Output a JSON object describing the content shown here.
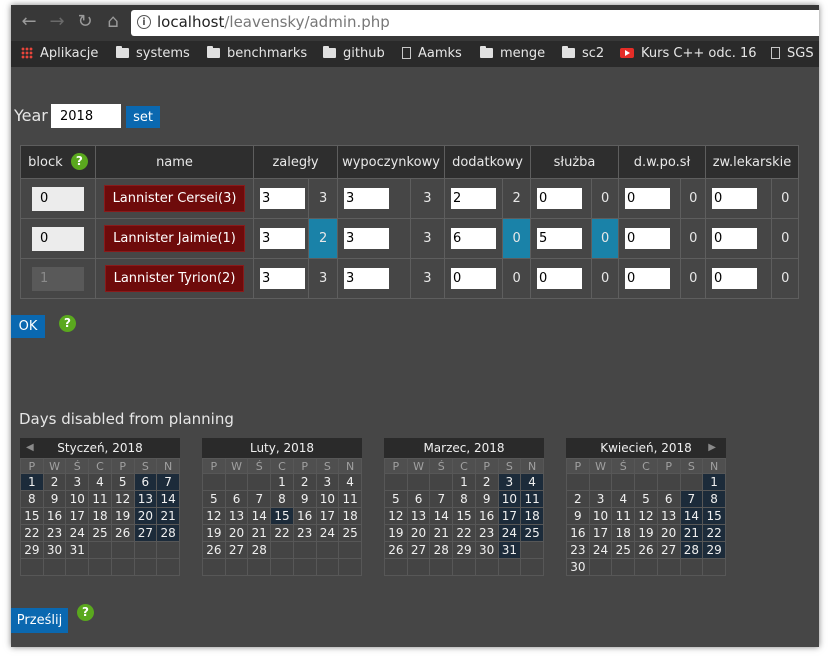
{
  "browser": {
    "url_host": "localhost",
    "url_path": "/leavensky/admin.php",
    "bookmarks": [
      "Aplikacje",
      "systems",
      "benchmarks",
      "github",
      "Aamks",
      "menge",
      "sc2",
      "Kurs C++ odc. 16",
      "SGS"
    ]
  },
  "year": {
    "label": "Year",
    "value": "2018",
    "set_label": "set"
  },
  "table": {
    "headers": [
      "block",
      "name",
      "zaległy",
      "wypoczynkowy",
      "dodatkowy",
      "służba",
      "d.w.po.sł",
      "zw.lekarskie"
    ],
    "help_symbol": "?",
    "rows": [
      {
        "block": "0",
        "block_disabled": false,
        "name": "Lannister Cersei(3)",
        "cells": [
          [
            "3",
            "3"
          ],
          [
            "3",
            "3"
          ],
          [
            "2",
            "2"
          ],
          [
            "0",
            "0"
          ],
          [
            "0",
            "0"
          ],
          [
            "0",
            "0"
          ]
        ],
        "highlight": [
          false,
          false,
          false,
          false,
          false,
          false
        ]
      },
      {
        "block": "0",
        "block_disabled": false,
        "name": "Lannister Jaimie(1)",
        "cells": [
          [
            "3",
            "2"
          ],
          [
            "3",
            "3"
          ],
          [
            "6",
            "0"
          ],
          [
            "5",
            "0"
          ],
          [
            "0",
            "0"
          ],
          [
            "0",
            "0"
          ]
        ],
        "highlight": [
          true,
          false,
          true,
          true,
          false,
          false
        ]
      },
      {
        "block": "1",
        "block_disabled": true,
        "name": "Lannister Tyrion(2)",
        "cells": [
          [
            "3",
            "3"
          ],
          [
            "3",
            "3"
          ],
          [
            "0",
            "0"
          ],
          [
            "0",
            "0"
          ],
          [
            "0",
            "0"
          ],
          [
            "0",
            "0"
          ]
        ],
        "highlight": [
          false,
          false,
          false,
          false,
          false,
          false
        ]
      }
    ]
  },
  "ok_label": "OK",
  "days_title": "Days disabled from planning",
  "day_names": [
    "P",
    "W",
    "Ś",
    "C",
    "P",
    "S",
    "N"
  ],
  "prev_arrow": "◀",
  "next_arrow": "▶",
  "months": [
    {
      "title": "Styczeń, 2018",
      "weeks": [
        [
          "1",
          "2",
          "3",
          "4",
          "5",
          "6",
          "7"
        ],
        [
          "8",
          "9",
          "10",
          "11",
          "12",
          "13",
          "14"
        ],
        [
          "15",
          "16",
          "17",
          "18",
          "19",
          "20",
          "21"
        ],
        [
          "22",
          "23",
          "24",
          "25",
          "26",
          "27",
          "28"
        ],
        [
          "29",
          "30",
          "31",
          "",
          "",
          "",
          ""
        ],
        [
          "",
          "",
          "",
          "",
          "",
          "",
          ""
        ]
      ],
      "disabled": [
        "1",
        "6",
        "7",
        "13",
        "14",
        "20",
        "21",
        "27",
        "28"
      ]
    },
    {
      "title": "Luty, 2018",
      "weeks": [
        [
          "",
          "",
          "",
          "1",
          "2",
          "3",
          "4"
        ],
        [
          "5",
          "6",
          "7",
          "8",
          "9",
          "10",
          "11"
        ],
        [
          "12",
          "13",
          "14",
          "15",
          "16",
          "17",
          "18"
        ],
        [
          "19",
          "20",
          "21",
          "22",
          "23",
          "24",
          "25"
        ],
        [
          "26",
          "27",
          "28",
          "",
          "",
          "",
          ""
        ],
        [
          "",
          "",
          "",
          "",
          "",
          "",
          ""
        ]
      ],
      "disabled": [
        "15"
      ]
    },
    {
      "title": "Marzec, 2018",
      "weeks": [
        [
          "",
          "",
          "",
          "1",
          "2",
          "3",
          "4"
        ],
        [
          "5",
          "6",
          "7",
          "8",
          "9",
          "10",
          "11"
        ],
        [
          "12",
          "13",
          "14",
          "15",
          "16",
          "17",
          "18"
        ],
        [
          "19",
          "20",
          "21",
          "22",
          "23",
          "24",
          "25"
        ],
        [
          "26",
          "27",
          "28",
          "29",
          "30",
          "31",
          ""
        ],
        [
          "",
          "",
          "",
          "",
          "",
          "",
          ""
        ]
      ],
      "disabled": [
        "3",
        "4",
        "10",
        "11",
        "17",
        "18",
        "24",
        "25",
        "31"
      ]
    },
    {
      "title": "Kwiecień, 2018",
      "weeks": [
        [
          "",
          "",
          "",
          "",
          "",
          "",
          "1"
        ],
        [
          "2",
          "3",
          "4",
          "5",
          "6",
          "7",
          "8"
        ],
        [
          "9",
          "10",
          "11",
          "12",
          "13",
          "14",
          "15"
        ],
        [
          "16",
          "17",
          "18",
          "19",
          "20",
          "21",
          "22"
        ],
        [
          "23",
          "24",
          "25",
          "26",
          "27",
          "28",
          "29"
        ],
        [
          "30",
          "",
          "",
          "",
          "",
          "",
          ""
        ]
      ],
      "disabled": [
        "1",
        "7",
        "8",
        "14",
        "15",
        "21",
        "22",
        "28",
        "29"
      ]
    }
  ],
  "submit_label": "Prześlij",
  "colors": {
    "disabled_day": "#1c2b3a",
    "highlight": "#1a82a8",
    "name_button": "#6e0b0b",
    "primary": "#0a68b0",
    "help": "#5aa81e"
  }
}
